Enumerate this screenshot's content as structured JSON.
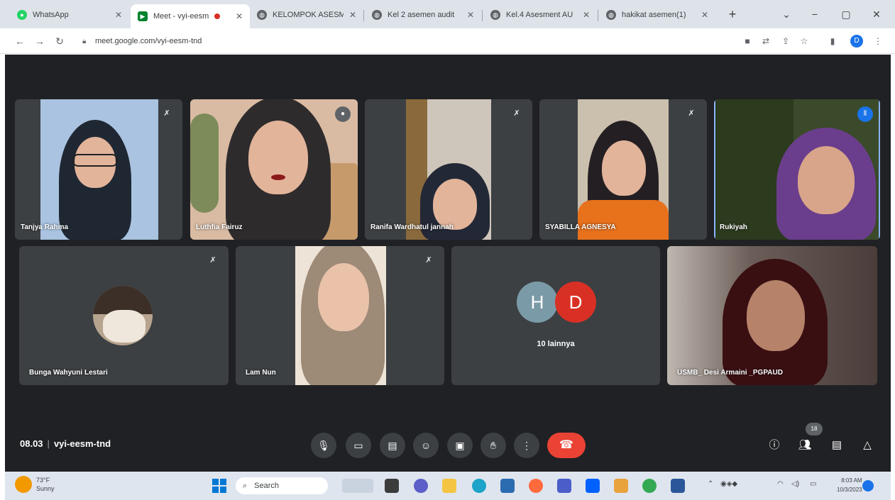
{
  "browser": {
    "tabs": [
      {
        "title": "WhatsApp",
        "icon": "whatsapp-icon",
        "color": "#25d366"
      },
      {
        "title": "Meet - vyi-eesm",
        "icon": "meet-icon",
        "color": "#00832d",
        "active": true
      },
      {
        "title": "KELOMPOK ASESM",
        "icon": "globe-icon",
        "color": "#5f6368"
      },
      {
        "title": "Kel 2 asemen audit",
        "icon": "globe-icon",
        "color": "#5f6368"
      },
      {
        "title": "Kel.4 Asesment AU",
        "icon": "globe-icon",
        "color": "#5f6368"
      },
      {
        "title": "hakikat asemen(1)",
        "icon": "globe-icon",
        "color": "#5f6368"
      }
    ],
    "new_tab": "+",
    "window_controls": [
      "⌄",
      "−",
      "▢",
      "✕"
    ],
    "url": "meet.google.com/vyi-eesm-tnd",
    "profile_initial": "D"
  },
  "meet": {
    "participants": [
      {
        "name": "Tanjya Rahma",
        "muted": true
      },
      {
        "name": "Luthfia Fairuz",
        "muted": false
      },
      {
        "name": "Ranifa Wardhatul jannah",
        "muted": true
      },
      {
        "name": "SYABILLA AGNESYA",
        "muted": true
      },
      {
        "name": "Rukiyah",
        "speaking": true
      },
      {
        "name": "Bunga Wahyuni Lestari",
        "muted": true
      },
      {
        "name": "Lam Nun",
        "muted": true
      },
      {
        "name": "USMB_ Desi Armaini _PGPAUD",
        "muted": false
      }
    ],
    "others": {
      "label": "10 lainnya",
      "initials": [
        "H",
        "D"
      ],
      "colors": [
        "#7b9aa8",
        "#d93025"
      ]
    },
    "time": "08.03",
    "meeting_code": "vyi-eesm-tnd",
    "participant_count": "18",
    "accent_end_call": "#ea4335"
  },
  "taskbar": {
    "weather_temp": "73°F",
    "weather_desc": "Sunny",
    "search_placeholder": "Search",
    "time": "8:03 AM",
    "date": "10/3/2023"
  }
}
